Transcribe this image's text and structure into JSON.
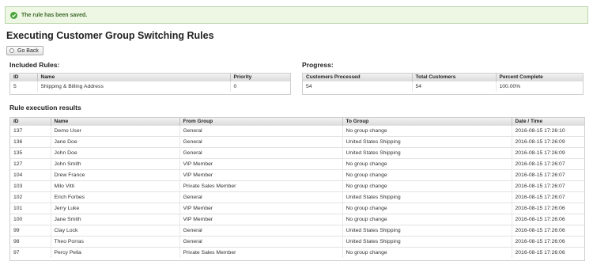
{
  "notice": {
    "text": "The rule has been saved."
  },
  "page": {
    "title": "Executing Customer Group Switching Rules"
  },
  "toolbar": {
    "go_back_label": "Go Back"
  },
  "included_rules": {
    "title": "Included Rules:",
    "columns": [
      "ID",
      "Name",
      "Priority"
    ],
    "rows": [
      {
        "id": "5",
        "name": "Shipping & Billing Address",
        "priority": "0"
      }
    ]
  },
  "progress": {
    "title": "Progress:",
    "columns": [
      "Customers Processed",
      "Total Customers",
      "Percent Complete"
    ],
    "rows": [
      {
        "processed": "54",
        "total": "54",
        "percent": "100.00%"
      }
    ]
  },
  "results": {
    "title": "Rule execution results",
    "columns": [
      "ID",
      "Name",
      "From Group",
      "To Group",
      "Date / Time"
    ],
    "rows": [
      {
        "id": "137",
        "name": "Demo User",
        "from": "General",
        "to": "No group change",
        "date": "2016-08-15 17:26:10"
      },
      {
        "id": "136",
        "name": "Jane Doe",
        "from": "General",
        "to": "United States Shipping",
        "date": "2016-08-15 17:26:09"
      },
      {
        "id": "135",
        "name": "John Doe",
        "from": "General",
        "to": "United States Shipping",
        "date": "2016-08-15 17:26:09"
      },
      {
        "id": "127",
        "name": "John Smith",
        "from": "VIP Member",
        "to": "No group change",
        "date": "2016-08-15 17:26:07"
      },
      {
        "id": "104",
        "name": "Drew France",
        "from": "VIP Member",
        "to": "No group change",
        "date": "2016-08-15 17:26:07"
      },
      {
        "id": "103",
        "name": "Milo Vitti",
        "from": "Private Sales Member",
        "to": "No group change",
        "date": "2016-08-15 17:26:07"
      },
      {
        "id": "102",
        "name": "Erich Forbes",
        "from": "General",
        "to": "United States Shipping",
        "date": "2016-08-15 17:26:07"
      },
      {
        "id": "101",
        "name": "Jerry Luke",
        "from": "VIP Member",
        "to": "No group change",
        "date": "2016-08-15 17:26:06"
      },
      {
        "id": "100",
        "name": "Jane Smith",
        "from": "VIP Member",
        "to": "No group change",
        "date": "2016-08-15 17:26:06"
      },
      {
        "id": "99",
        "name": "Clay Lock",
        "from": "General",
        "to": "United States Shipping",
        "date": "2016-08-15 17:26:06"
      },
      {
        "id": "98",
        "name": "Theo Porras",
        "from": "General",
        "to": "United States Shipping",
        "date": "2016-08-15 17:26:06"
      },
      {
        "id": "97",
        "name": "Percy Pella",
        "from": "Private Sales Member",
        "to": "No group change",
        "date": "2016-08-15 17:26:06"
      }
    ]
  },
  "colors": {
    "success_bg": "#eef6e4",
    "success_border": "#b8d4a8",
    "success_icon": "#4aa43a"
  }
}
